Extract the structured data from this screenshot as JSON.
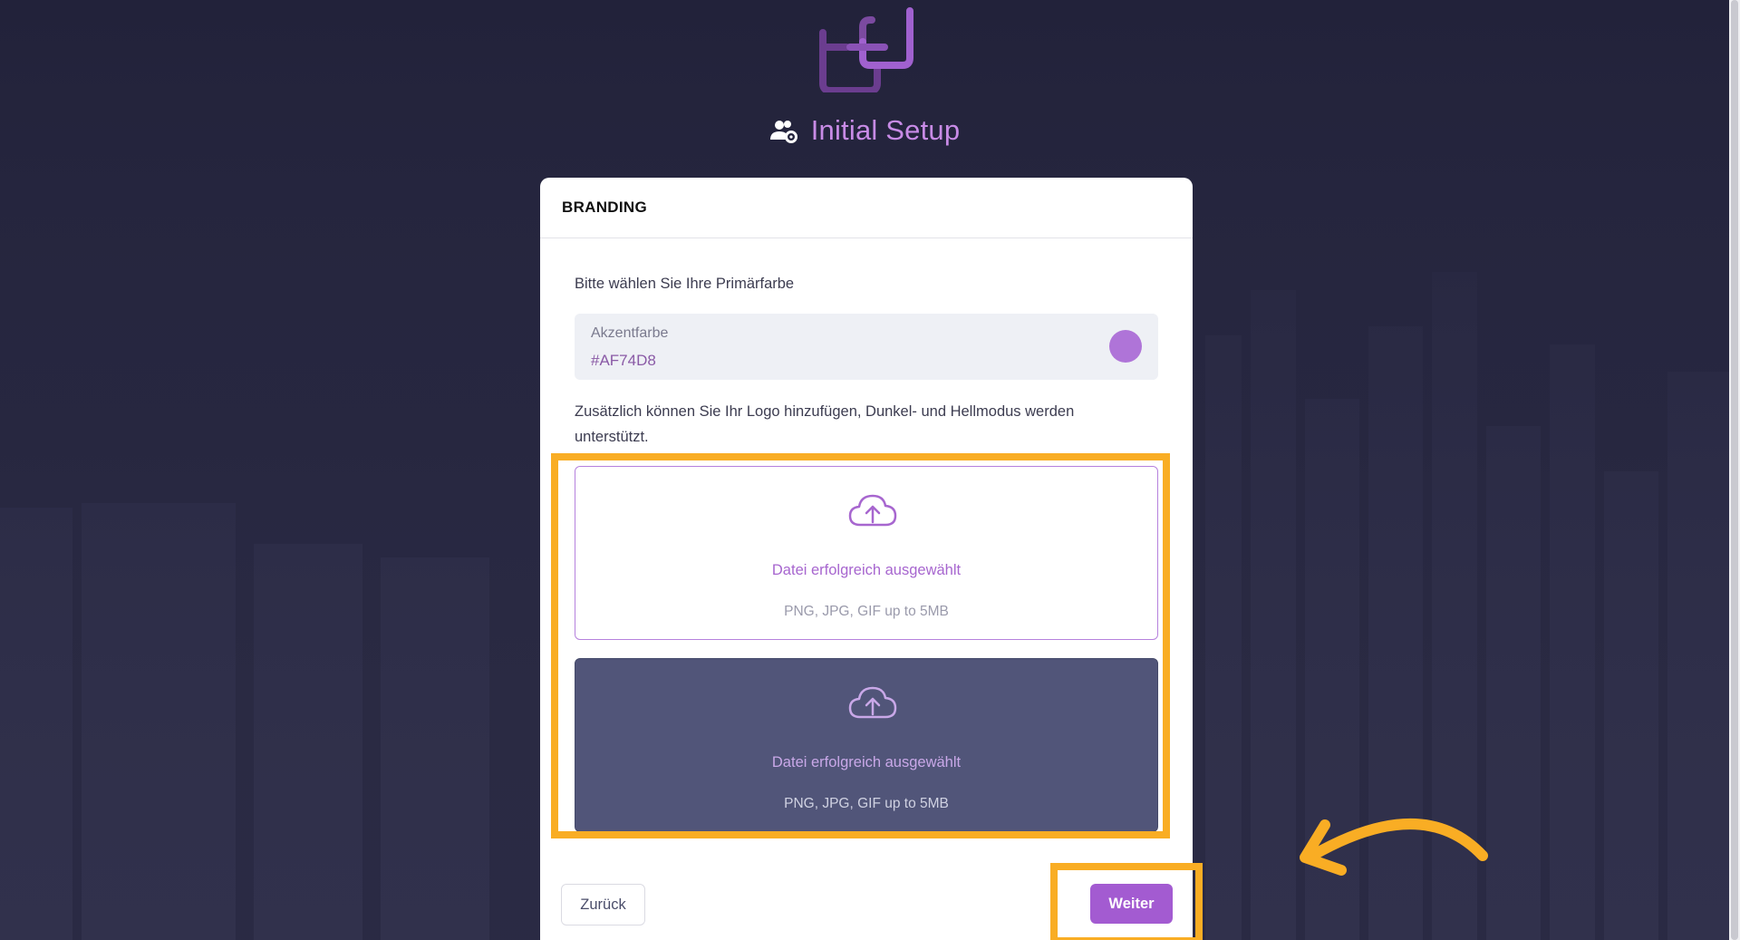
{
  "header": {
    "title": "Initial Setup",
    "title_icon": "users-gear-icon",
    "logo": "chain-link-logo"
  },
  "card": {
    "section_title": "BRANDING",
    "prompt": "Bitte wählen Sie Ihre Primärfarbe",
    "accent_field": {
      "label": "Akzentfarbe",
      "value": "#AF74D8",
      "swatch_color": "#AF74D8"
    },
    "logo_info": "Zusätzlich können Sie Ihr Logo hinzufügen, Dunkel- und Hellmodus werden unterstützt.",
    "dropzones": [
      {
        "mode": "light",
        "icon": "cloud-upload-icon",
        "status": "Datei erfolgreich ausgewählt",
        "hint": "PNG, JPG, GIF up to 5MB"
      },
      {
        "mode": "dark",
        "icon": "cloud-upload-icon",
        "status": "Datei erfolgreich ausgewählt",
        "hint": "PNG, JPG, GIF up to 5MB"
      }
    ],
    "back_label": "Zurück",
    "next_label": "Weiter"
  },
  "colors": {
    "background": "#22223a",
    "accent": "#AF74D8",
    "highlight": "#F9AD24",
    "dark_dropzone": "#515579"
  }
}
